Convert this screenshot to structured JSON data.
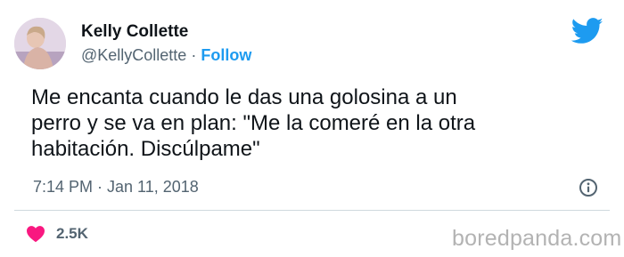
{
  "author": {
    "name": "Kelly Collette",
    "handle": "@KellyCollette",
    "separator": " · ",
    "follow_label": "Follow"
  },
  "tweet": {
    "lines": [
      "Me encanta cuando le das una golosina a un",
      "perro y se va en plan: \"Me la comeré en la otra",
      "habitación. Discúlpame\""
    ],
    "timestamp": "7:14 PM · Jan 11, 2018",
    "likes": "2.5K"
  },
  "watermark": "boredpanda.com",
  "icons": {
    "brand": "twitter-bird-icon",
    "info": "info-icon",
    "like": "heart-icon"
  },
  "colors": {
    "accent": "#1d9bf0",
    "like": "#f91880",
    "secondary_text": "#536471"
  }
}
